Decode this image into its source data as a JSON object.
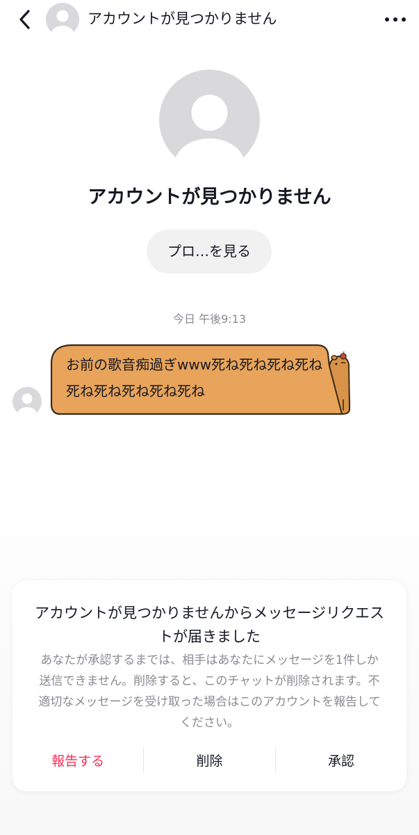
{
  "header": {
    "back_icon": "chevron-left-icon",
    "title": "アカウントが見つかりません",
    "more_icon": "more-horizontal-icon"
  },
  "profile": {
    "name": "アカウントが見つかりません",
    "view_profile_label": "プロ…を見る"
  },
  "chat": {
    "timestamp": "今日 午後9:13",
    "messages": [
      {
        "text": "お前の歌音痴過ぎwww死ね死ね死ね死ね死ね死ね死ね死ね死ね",
        "bubble_color": "#e8a45b",
        "decoration": "capybara-sticker"
      }
    ]
  },
  "request": {
    "title": "アカウントが見つかりませんからメッセージリクエストが届きました",
    "body": "あなたが承認するまでは、相手はあなたにメッセージを1件しか送信できません。削除すると、このチャットが削除されます。不適切なメッセージを受け取った場合はこのアカウントを報告してください。",
    "actions": {
      "report": "報告する",
      "delete": "削除",
      "accept": "承認"
    }
  },
  "colors": {
    "danger": "#fe2c55",
    "muted_text": "#8a8b91",
    "avatar_bg": "#d9d9db",
    "pill_bg": "#f1f1f2"
  }
}
